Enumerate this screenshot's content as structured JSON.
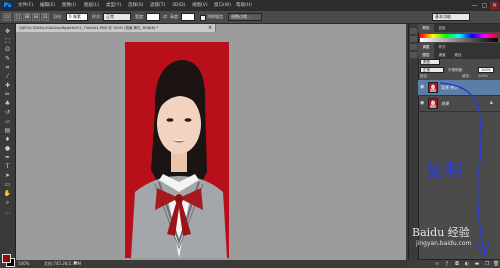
{
  "app": {
    "logo": "Ps",
    "menu": [
      "文件(F)",
      "编辑(E)",
      "图像(I)",
      "图层(L)",
      "类型(Y)",
      "选择(S)",
      "滤镜(T)",
      "3D(D)",
      "视图(V)",
      "窗口(W)",
      "帮助(H)"
    ],
    "window_controls": [
      "—",
      "▢",
      "✕"
    ]
  },
  "options": {
    "feather_label": "羽化:",
    "feather_value": "0 像素",
    "style_label": "样式:",
    "style_value": "正常",
    "width_label": "宽度:",
    "height_label": "高度:",
    "remove_artifacts_label": "消除锯齿",
    "refine_edge_label": "调整边缘...",
    "workspace": "基本功能"
  },
  "document": {
    "tab_title": "QjtFOU-S308ry10AA4Ayl6gzbHk291_700x0x1.PNG @ 100% (背景 拷贝, RGB/8) *",
    "zoom": "100%",
    "doc_info": "文档:745.2K/1.48M"
  },
  "colors": {
    "accent_red": "#b80f1b",
    "foreground": "#8e0b0b",
    "background": "#000000",
    "selection_blue": "#5b7ea6"
  },
  "panels": {
    "top_tabs": [
      "颜色",
      "色板"
    ],
    "mid_tabs": [
      "调整",
      "样式"
    ],
    "layer_tabs": [
      "图层",
      "通道",
      "路径"
    ],
    "filter_label": "类型",
    "blend_mode": "正常",
    "opacity_label": "不透明度:",
    "opacity_value": "100%",
    "lock_label": "锁定:",
    "fill_label": "填充:",
    "fill_value": "100%",
    "layers": [
      {
        "name": "背景 拷贝",
        "selected": true
      },
      {
        "name": "背景",
        "selected": false
      }
    ]
  },
  "annotation": {
    "handwritten": "复制",
    "watermark_brand": "Baidu 经验",
    "watermark_url": "jingyan.baidu.com"
  }
}
